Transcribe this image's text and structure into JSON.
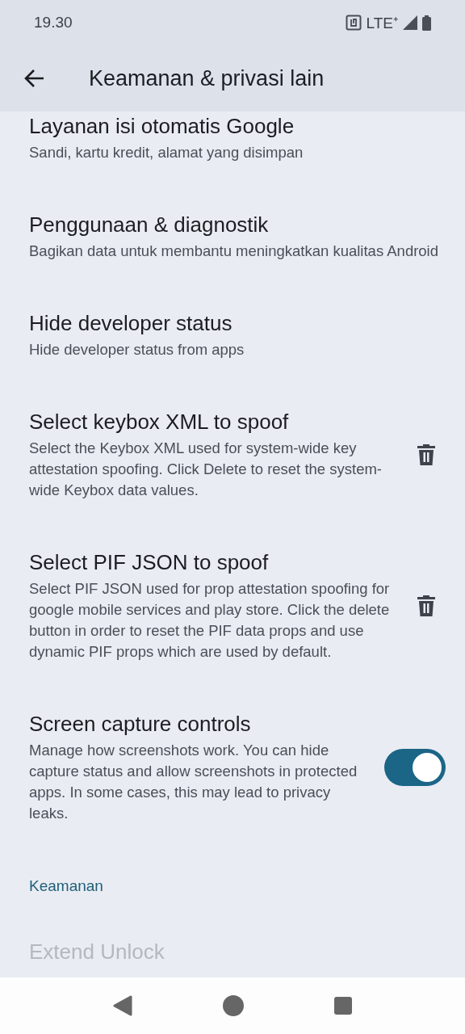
{
  "status_bar": {
    "time": "19.30",
    "network": "LTE⁺"
  },
  "header": {
    "title": "Keamanan & privasi lain"
  },
  "items": [
    {
      "kind": "plain",
      "title": "Layanan isi otomatis Google",
      "description": "Sandi, kartu kredit, alamat yang disimpan"
    },
    {
      "kind": "plain",
      "title": "Penggunaan & diagnostik",
      "description": "Bagikan data untuk membantu meningkatkan kualitas Android"
    },
    {
      "kind": "plain",
      "title": "Hide developer status",
      "description": "Hide developer status from apps"
    },
    {
      "kind": "delete",
      "title": "Select keybox XML to spoof",
      "description": "Select the Keybox XML used for system-wide key attestation spoofing. Click Delete to reset the system-wide Keybox data values."
    },
    {
      "kind": "delete",
      "title": "Select PIF JSON to spoof",
      "description": "Select PIF JSON used for prop attestation spoofing for google mobile services and play store. Click the delete button in order to reset the PIF data props and use dynamic PIF props which are used by default."
    },
    {
      "kind": "toggle",
      "title": "Screen capture controls",
      "description": "Manage how screenshots work. You can hide capture status and allow screenshots in protected apps. In some cases, this may lead to privacy leaks.",
      "on": true
    }
  ],
  "section": {
    "title": "Keamanan"
  },
  "disabled_item": {
    "title": "Extend Unlock",
    "disabled": true
  }
}
